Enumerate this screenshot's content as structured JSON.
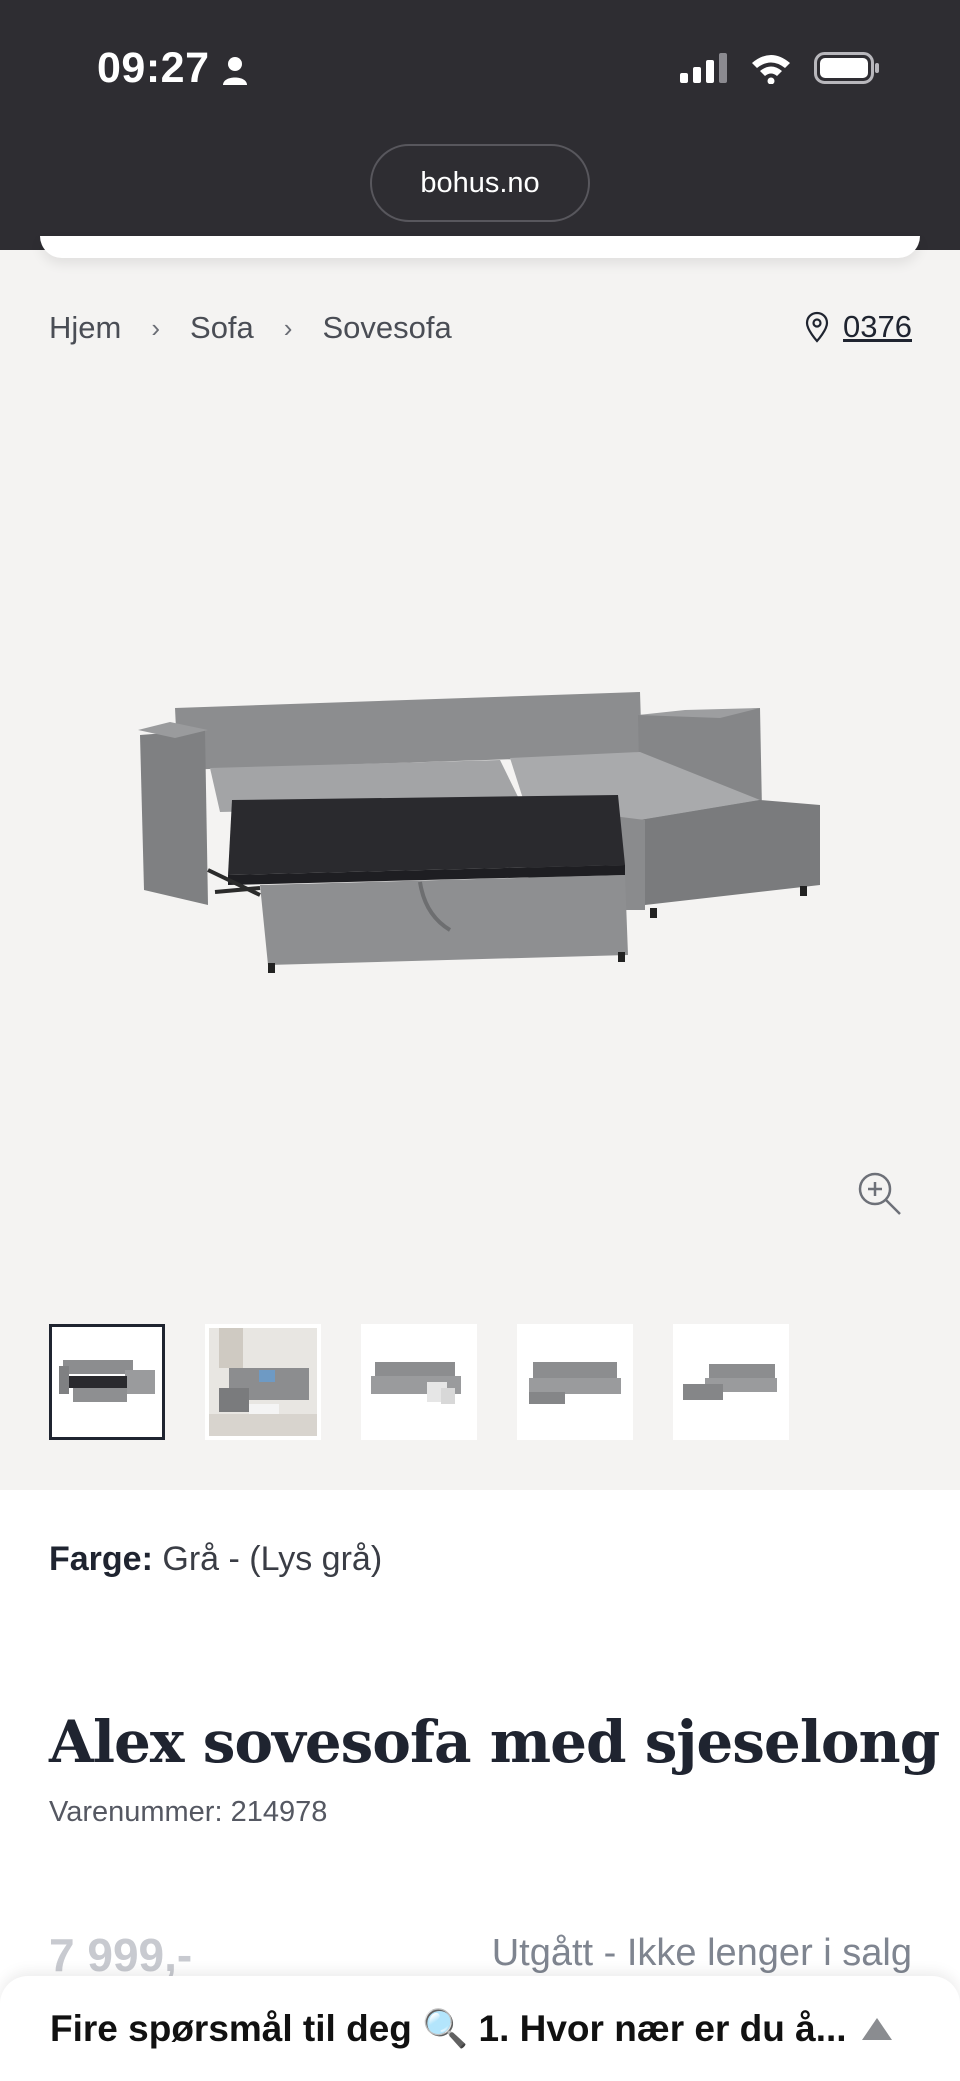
{
  "status_bar": {
    "time": "09:27",
    "url": "bohus.no"
  },
  "breadcrumb": {
    "items": [
      "Hjem",
      "Sofa",
      "Sovesofa"
    ],
    "separator": "›"
  },
  "store": {
    "code": "0376"
  },
  "product": {
    "color_label": "Farge:",
    "color_value": "Grå - (Lys grå)",
    "title": "Alex sovesofa med sjeselong",
    "sku": "Varenummer: 214978",
    "price": "7 999,-",
    "availability": "Utgått - Ikke lenger i salg"
  },
  "thumbnails": [
    "sofa-bed-open",
    "sofa-room-scene",
    "sofa-with-ottoman",
    "sofa-front",
    "sofa-side"
  ],
  "bottom_bar": {
    "text": "Fire spørsmål til deg 🔍 1. Hvor nær er du å..."
  },
  "colors": {
    "status_bg": "#2e2d32",
    "page_bg": "#f4f3f2",
    "text_dark": "#1f2430",
    "muted": "#7f8590"
  }
}
